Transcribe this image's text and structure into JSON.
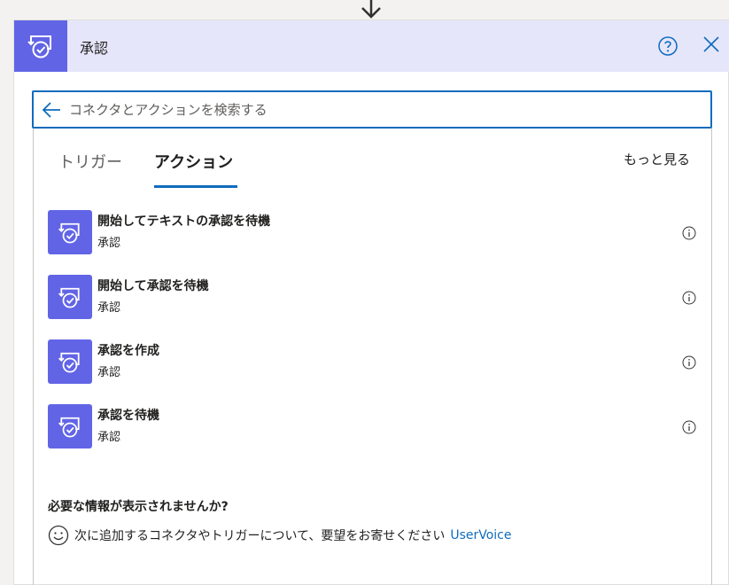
{
  "flow": {
    "connector_arrow_icon": "arrow-down-icon"
  },
  "header": {
    "title": "承認",
    "icon": "approval-icon",
    "background": "#e6e6fb",
    "icon_background": "#6264e6",
    "help_icon": "help-circle-icon",
    "close_icon": "close-icon"
  },
  "search": {
    "placeholder": "コネクタとアクションを検索する",
    "value": "",
    "back_icon": "arrow-left-icon",
    "border_color": "#0f6cbd"
  },
  "tabs": [
    {
      "label": "トリガー",
      "selected": false
    },
    {
      "label": "アクション",
      "selected": true
    }
  ],
  "see_more": "もっと見る",
  "actions": [
    {
      "name": "開始してテキストの承認を待機",
      "connector": "承認",
      "icon": "approval-icon",
      "info_icon": "info-icon"
    },
    {
      "name": "開始して承認を待機",
      "connector": "承認",
      "icon": "approval-icon",
      "info_icon": "info-icon"
    },
    {
      "name": "承認を作成",
      "connector": "承認",
      "icon": "approval-icon",
      "info_icon": "info-icon"
    },
    {
      "name": "承認を待機",
      "connector": "承認",
      "icon": "approval-icon",
      "info_icon": "info-icon"
    }
  ],
  "missing": {
    "title": "必要な情報が表示されませんか?",
    "icon": "smile-icon",
    "text": "次に追加するコネクタやトリガーについて、要望をお寄せください",
    "link": "UserVoice"
  },
  "colors": {
    "accent": "#0f6cbd",
    "brand": "#6264e6"
  }
}
